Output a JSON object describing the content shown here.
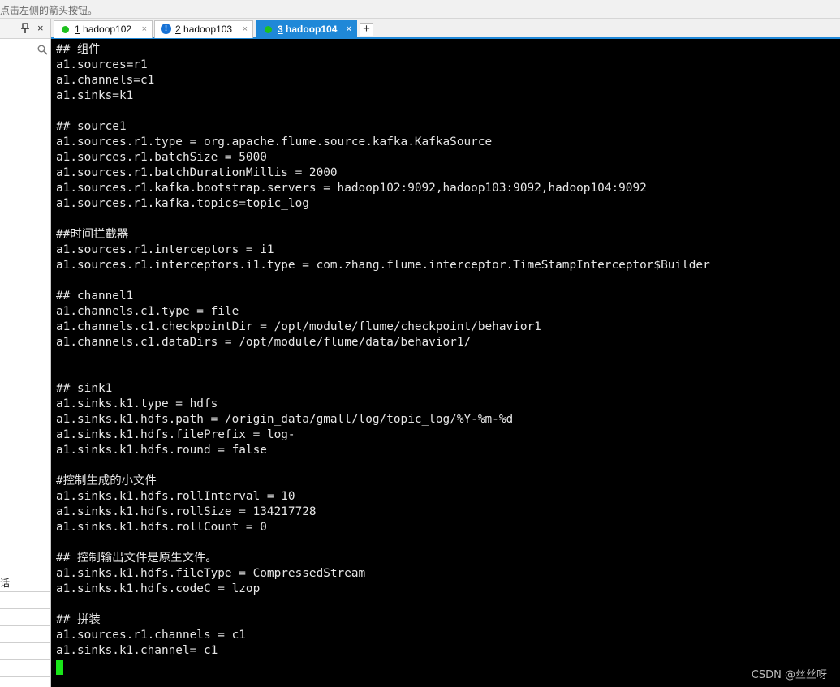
{
  "hint": {
    "text": "点击左侧的箭头按钮。"
  },
  "left_panel": {
    "rows": [
      "话",
      "",
      "",
      "",
      "",
      "",
      ""
    ]
  },
  "tabs": [
    {
      "num": "1",
      "name": "hadoop102",
      "status": "connected",
      "close": "×"
    },
    {
      "num": "2",
      "name": "hadoop103",
      "status": "warning",
      "warn_glyph": "!",
      "close": "×"
    },
    {
      "num": "3",
      "name": "hadoop104",
      "status": "connected",
      "active": true,
      "close": "×"
    }
  ],
  "tab_add_label": "+",
  "terminal": {
    "lines": [
      "## 组件",
      "a1.sources=r1",
      "a1.channels=c1",
      "a1.sinks=k1",
      "",
      "## source1",
      "a1.sources.r1.type = org.apache.flume.source.kafka.KafkaSource",
      "a1.sources.r1.batchSize = 5000",
      "a1.sources.r1.batchDurationMillis = 2000",
      "a1.sources.r1.kafka.bootstrap.servers = hadoop102:9092,hadoop103:9092,hadoop104:9092",
      "a1.sources.r1.kafka.topics=topic_log",
      "",
      "##时间拦截器",
      "a1.sources.r1.interceptors = i1",
      "a1.sources.r1.interceptors.i1.type = com.zhang.flume.interceptor.TimeStampInterceptor$Builder",
      "",
      "## channel1",
      "a1.channels.c1.type = file",
      "a1.channels.c1.checkpointDir = /opt/module/flume/checkpoint/behavior1",
      "a1.channels.c1.dataDirs = /opt/module/flume/data/behavior1/",
      "",
      "",
      "## sink1",
      "a1.sinks.k1.type = hdfs",
      "a1.sinks.k1.hdfs.path = /origin_data/gmall/log/topic_log/%Y-%m-%d",
      "a1.sinks.k1.hdfs.filePrefix = log-",
      "a1.sinks.k1.hdfs.round = false",
      "",
      "#控制生成的小文件",
      "a1.sinks.k1.hdfs.rollInterval = 10",
      "a1.sinks.k1.hdfs.rollSize = 134217728",
      "a1.sinks.k1.hdfs.rollCount = 0",
      "",
      "## 控制输出文件是原生文件。",
      "a1.sinks.k1.hdfs.fileType = CompressedStream",
      "a1.sinks.k1.hdfs.codeC = lzop",
      "",
      "## 拼装",
      "a1.sources.r1.channels = c1",
      "a1.sinks.k1.channel= c1"
    ],
    "watermark": "CSDN @丝丝呀"
  },
  "colors": {
    "tab_active": "#1f88d8",
    "terminal_bg": "#000000",
    "terminal_fg": "#e6e6e6",
    "cursor": "#19e619",
    "status_connected": "#1ec11e",
    "status_warning": "#1672d6"
  },
  "icons": {
    "pin": "pin-icon",
    "search": "search-icon",
    "status_connected": "status-dot-icon",
    "status_warning": "warning-icon",
    "add_tab": "plus-icon"
  }
}
